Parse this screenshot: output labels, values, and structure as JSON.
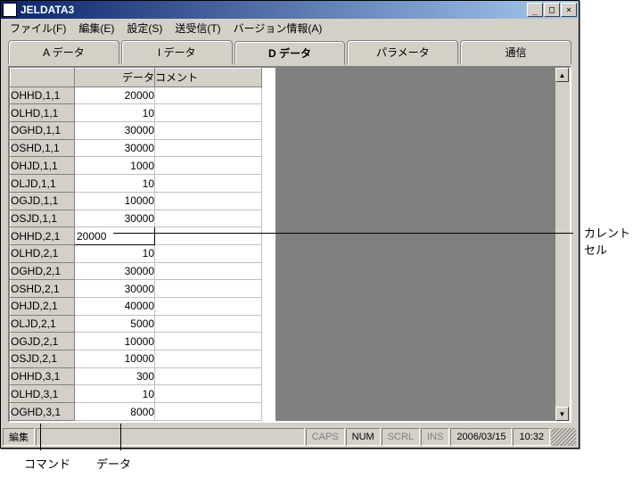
{
  "window": {
    "title": "JELDATA3",
    "buttons": {
      "min": "_",
      "max": "□",
      "close": "×"
    }
  },
  "menu": {
    "file": "ファイル(F)",
    "edit": "編集(E)",
    "settings": "設定(S)",
    "send": "送受信(T)",
    "version": "バージョン情報(A)"
  },
  "tabs": {
    "a": "A データ",
    "i": "I データ",
    "d": "D データ",
    "param": "パラメータ",
    "comm": "通信"
  },
  "grid": {
    "hdr_cmd": "",
    "hdr_data": "データ",
    "hdr_comment": "コメント",
    "rows": [
      {
        "cmd": "OHHD,1,1",
        "data": "20000",
        "c": ""
      },
      {
        "cmd": "OLHD,1,1",
        "data": "10",
        "c": ""
      },
      {
        "cmd": "OGHD,1,1",
        "data": "30000",
        "c": ""
      },
      {
        "cmd": "OSHD,1,1",
        "data": "30000",
        "c": ""
      },
      {
        "cmd": "OHJD,1,1",
        "data": "1000",
        "c": ""
      },
      {
        "cmd": "OLJD,1,1",
        "data": "10",
        "c": ""
      },
      {
        "cmd": "OGJD,1,1",
        "data": "10000",
        "c": ""
      },
      {
        "cmd": "OSJD,1,1",
        "data": "30000",
        "c": ""
      },
      {
        "cmd": "OHHD,2,1",
        "data": "20000",
        "c": "",
        "editing": true
      },
      {
        "cmd": "OLHD,2,1",
        "data": "10",
        "c": ""
      },
      {
        "cmd": "OGHD,2,1",
        "data": "30000",
        "c": ""
      },
      {
        "cmd": "OSHD,2,1",
        "data": "30000",
        "c": ""
      },
      {
        "cmd": "OHJD,2,1",
        "data": "40000",
        "c": ""
      },
      {
        "cmd": "OLJD,2,1",
        "data": "5000",
        "c": ""
      },
      {
        "cmd": "OGJD,2,1",
        "data": "10000",
        "c": ""
      },
      {
        "cmd": "OSJD,2,1",
        "data": "10000",
        "c": ""
      },
      {
        "cmd": "OHHD,3,1",
        "data": "300",
        "c": ""
      },
      {
        "cmd": "OLHD,3,1",
        "data": "10",
        "c": ""
      },
      {
        "cmd": "OGHD,3,1",
        "data": "8000",
        "c": ""
      }
    ]
  },
  "status": {
    "mode": "編集",
    "caps": "CAPS",
    "num": "NUM",
    "scrl": "SCRL",
    "ins": "INS",
    "date": "2006/03/15",
    "time": "10:32"
  },
  "annotations": {
    "current_cell_1": "カレント",
    "current_cell_2": "セル",
    "command": "コマンド",
    "data": "データ"
  }
}
